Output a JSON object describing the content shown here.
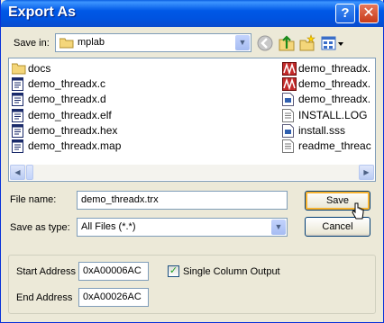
{
  "window": {
    "title": "Export As",
    "help_glyph": "?",
    "close_glyph": "✕"
  },
  "toolbar": {
    "save_in_label": "Save in:",
    "save_in_value": "mplab",
    "icons": [
      "back-icon",
      "up-folder-icon",
      "new-folder-icon",
      "view-menu-icon"
    ]
  },
  "files": {
    "left_column": [
      {
        "name": "docs",
        "icon": "folder-icon"
      },
      {
        "name": "demo_threadx.c",
        "icon": "c-file-icon"
      },
      {
        "name": "demo_threadx.d",
        "icon": "d-file-icon"
      },
      {
        "name": "demo_threadx.elf",
        "icon": "elf-file-icon"
      },
      {
        "name": "demo_threadx.hex",
        "icon": "hex-file-icon"
      },
      {
        "name": "demo_threadx.map",
        "icon": "map-file-icon"
      }
    ],
    "right_column": [
      {
        "name": "demo_threadx.",
        "icon": "mplab-project-icon"
      },
      {
        "name": "demo_threadx.",
        "icon": "mplab-project-icon"
      },
      {
        "name": "demo_threadx.",
        "icon": "file-icon"
      },
      {
        "name": "INSTALL.LOG",
        "icon": "text-file-icon"
      },
      {
        "name": "install.sss",
        "icon": "file-icon"
      },
      {
        "name": "readme_threac",
        "icon": "text-file-icon"
      }
    ]
  },
  "form": {
    "file_name_label": "File name:",
    "file_name_value": "demo_threadx.trx",
    "save_type_label": "Save as type:",
    "save_type_value": "All Files (*.*)",
    "save_button": "Save",
    "cancel_button": "Cancel"
  },
  "address": {
    "start_label": "Start Address",
    "start_value": "0xA00006AC",
    "end_label": "End Address",
    "end_value": "0xA00026AC",
    "single_column_label": "Single Column Output",
    "single_column_checked": true
  },
  "colors": {
    "titlebar": "#0058e6",
    "dialog_bg": "#ece9d8",
    "field_border": "#7f9db9",
    "default_button_glow": "#f8b330"
  }
}
